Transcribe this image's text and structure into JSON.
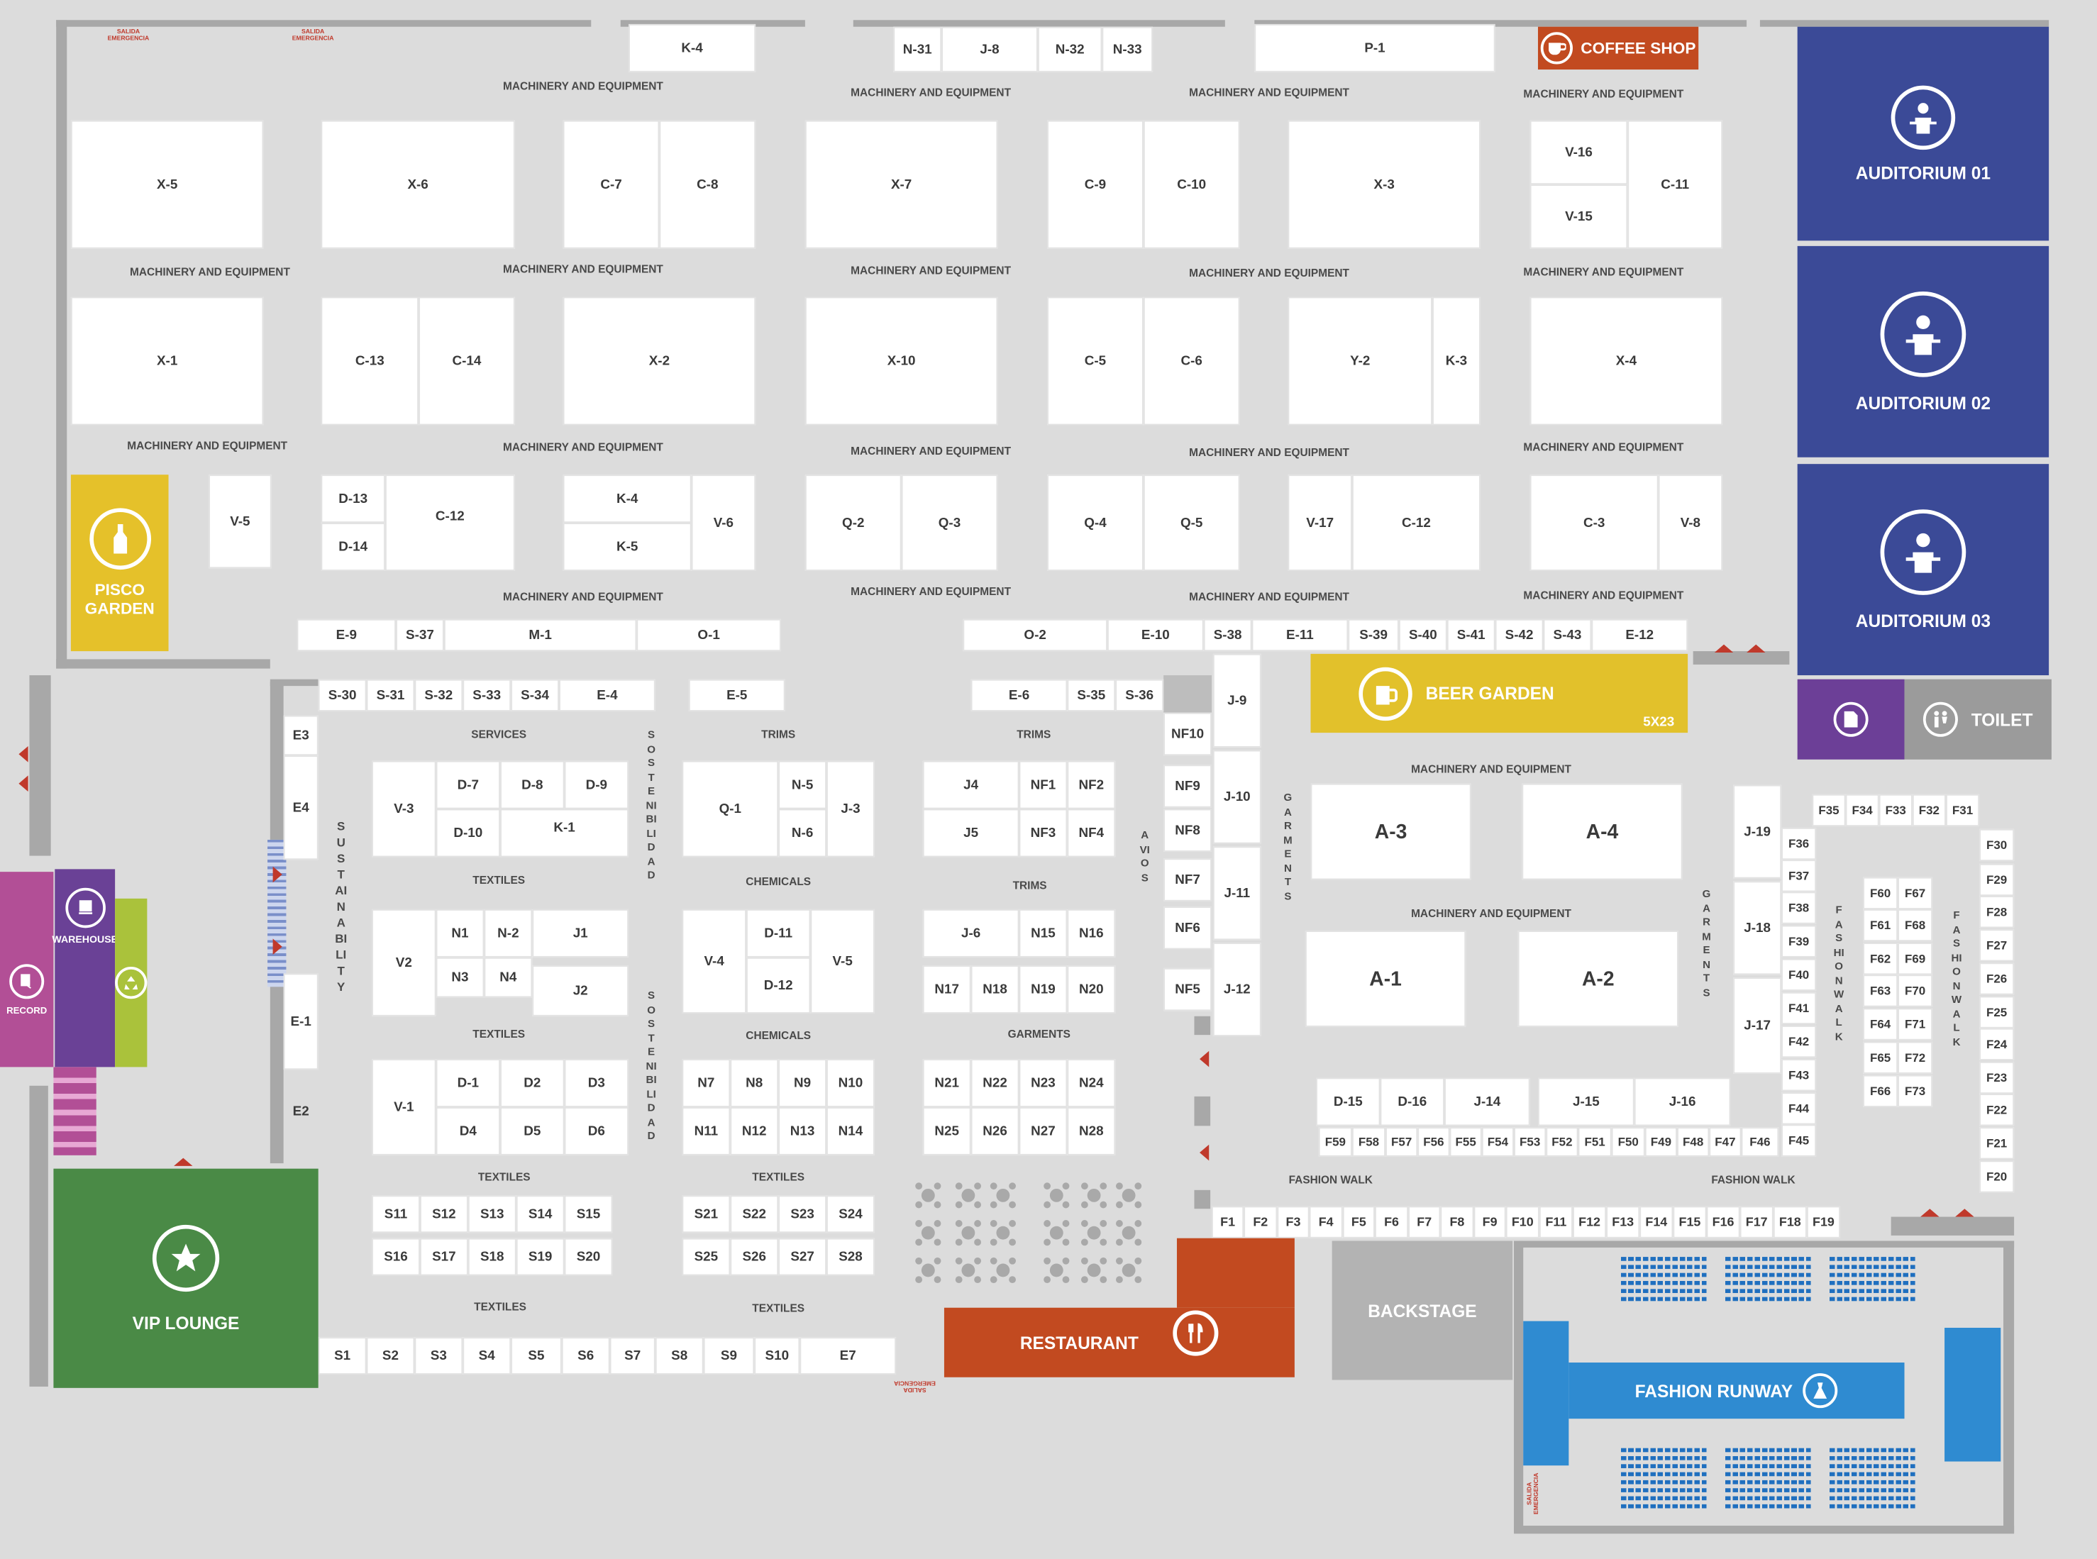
{
  "colors": {
    "auditorium": "#3b4a97",
    "pisco": "#e5c12a",
    "beer": "#e2c12b",
    "coffee": "#c24a20",
    "restaurant": "#c24a20",
    "vip": "#4a8a46",
    "backstage": "#b3b3b3",
    "runway": "#2f8bd1",
    "warehouse": "#6a4196",
    "record": "#b24f96",
    "recycle": "#aac23b",
    "purple_small": "#6c3f97",
    "toilet": "#9b9b9b"
  },
  "labels": {
    "mae": "MACHINERY AND EQUIPMENT",
    "services": "SERVICES",
    "trims": "TRIMS",
    "textiles": "TEXTILES",
    "chemicals": "CHEMICALS",
    "garments": "GARMENTS",
    "fashion_walk": "FASHION WALK",
    "sustainability": "SUSTAINABILITY",
    "sostenibilidad": "SOSTENIBILIDAD",
    "avios": "AVIOS",
    "garments_v": "GARMENTS",
    "fashion_walk_v": "FASHIONWALK",
    "auditorium_01": "AUDITORIUM 01",
    "auditorium_02": "AUDITORIUM 02",
    "auditorium_03": "AUDITORIUM 03",
    "coffee_shop": "COFFEE SHOP",
    "pisco_garden": "PISCO GARDEN",
    "beer_garden": "BEER GARDEN",
    "beer_size": "5X23",
    "toilet": "TOILET",
    "warehouse": "WAREHOUSE",
    "record": "RECORD",
    "vip_lounge": "VIP LOUNGE",
    "restaurant": "RESTAURANT",
    "backstage": "BACKSTAGE",
    "fashion_runway": "FASHION RUNWAY",
    "exit": "SALIDA EMERGENCIA"
  },
  "booths": {
    "K-4top": "K-4",
    "N-31": "N-31",
    "J-8": "J-8",
    "N-32": "N-32",
    "N-33": "N-33",
    "P-1": "P-1",
    "X-5": "X-5",
    "X-6": "X-6",
    "C-7": "C-7",
    "C-8": "C-8",
    "X-7": "X-7",
    "C-9": "C-9",
    "C-10": "C-10",
    "X-3": "X-3",
    "V-16": "V-16",
    "V-15": "V-15",
    "C-11": "C-11",
    "X-1": "X-1",
    "C-13": "C-13",
    "C-14": "C-14",
    "X-2": "X-2",
    "X-10": "X-10",
    "C-5": "C-5",
    "C-6": "C-6",
    "Y-2": "Y-2",
    "K-3": "K-3",
    "X-4": "X-4",
    "V-5": "V-5",
    "D-13": "D-13",
    "D-14": "D-14",
    "C-12a": "C-12",
    "K-4b": "K-4",
    "K-5": "K-5",
    "V-6": "V-6",
    "Q-2": "Q-2",
    "Q-3": "Q-3",
    "Q-4": "Q-4",
    "Q-5": "Q-5",
    "V-17": "V-17",
    "C-12b": "C-12",
    "C-3": "C-3",
    "V-8": "V-8",
    "E-9": "E-9",
    "S-37": "S-37",
    "M-1": "M-1",
    "O-1": "O-1",
    "O-2": "O-2",
    "E-10": "E-10",
    "S-38": "S-38",
    "E-11": "E-11",
    "S-39": "S-39",
    "S-40": "S-40",
    "S-41": "S-41",
    "S-42": "S-42",
    "S-43": "S-43",
    "E-12": "E-12",
    "S-30": "S-30",
    "S-31": "S-31",
    "S-32": "S-32",
    "S-33": "S-33",
    "S-34": "S-34",
    "E-4": "E-4",
    "E-5": "E-5",
    "E-6": "E-6",
    "S-35": "S-35",
    "S-36": "S-36",
    "E3": "E3",
    "E4": "E4",
    "E-1": "E-1",
    "E2": "E2",
    "V-3": "V-3",
    "D-7": "D-7",
    "D-8": "D-8",
    "D-9": "D-9",
    "D-10": "D-10",
    "K-1": "K-1",
    "V2": "V2",
    "N1": "N1",
    "N-2": "N-2",
    "J1": "J1",
    "N3": "N3",
    "N4": "N4",
    "J2": "J2",
    "V-1": "V-1",
    "D-1": "D-1",
    "D2": "D2",
    "D3": "D3",
    "D4": "D4",
    "D5": "D5",
    "D6": "D6",
    "S11": "S11",
    "S12": "S12",
    "S13": "S13",
    "S14": "S14",
    "S15": "S15",
    "S16": "S16",
    "S17": "S17",
    "S18": "S18",
    "S19": "S19",
    "S20": "S20",
    "S1": "S1",
    "S2": "S2",
    "S3": "S3",
    "S4": "S4",
    "S5": "S5",
    "S6": "S6",
    "S7": "S7",
    "S8": "S8",
    "S9": "S9",
    "S10": "S10",
    "E7": "E7",
    "Q-1": "Q-1",
    "N-5": "N-5",
    "N-6": "N-6",
    "J-3": "J-3",
    "V-4": "V-4",
    "D-11": "D-11",
    "D-12": "D-12",
    "V-5b": "V-5",
    "N7": "N7",
    "N8": "N8",
    "N9": "N9",
    "N10": "N10",
    "N11": "N11",
    "N12": "N12",
    "N13": "N13",
    "N14": "N14",
    "S21": "S21",
    "S22": "S22",
    "S23": "S23",
    "S24": "S24",
    "S25": "S25",
    "S26": "S26",
    "S27": "S27",
    "S28": "S28",
    "J4": "J4",
    "NF1": "NF1",
    "NF2": "NF2",
    "J5": "J5",
    "NF3": "NF3",
    "NF4": "NF4",
    "J-6": "J-6",
    "N15": "N15",
    "N16": "N16",
    "N17": "N17",
    "N18": "N18",
    "N19": "N19",
    "N20": "N20",
    "N21": "N21",
    "N22": "N22",
    "N23": "N23",
    "N24": "N24",
    "N25": "N25",
    "N26": "N26",
    "N27": "N27",
    "N28": "N28",
    "NF10": "NF10",
    "NF9": "NF9",
    "NF8": "NF8",
    "NF7": "NF7",
    "NF6": "NF6",
    "NF5": "NF5",
    "J-9": "J-9",
    "J-10": "J-10",
    "J-11": "J-11",
    "J-12": "J-12",
    "A-3": "A-3",
    "A-4": "A-4",
    "A-1": "A-1",
    "A-2": "A-2",
    "D-15": "D-15",
    "D-16": "D-16",
    "J-14": "J-14",
    "J-15": "J-15",
    "J-16": "J-16",
    "J-19": "J-19",
    "J-18": "J-18",
    "J-17": "J-17",
    "F35": "F35",
    "F34": "F34",
    "F33": "F33",
    "F32": "F32",
    "F31": "F31",
    "F36": "F36",
    "F37": "F37",
    "F38": "F38",
    "F39": "F39",
    "F40": "F40",
    "F41": "F41",
    "F42": "F42",
    "F43": "F43",
    "F44": "F44",
    "F45": "F45",
    "F60": "F60",
    "F67": "F67",
    "F61": "F61",
    "F68": "F68",
    "F62": "F62",
    "F69": "F69",
    "F63": "F63",
    "F70": "F70",
    "F64": "F64",
    "F71": "F71",
    "F65": "F65",
    "F72": "F72",
    "F66": "F66",
    "F73": "F73",
    "F30": "F30",
    "F29": "F29",
    "F28": "F28",
    "F27": "F27",
    "F26": "F26",
    "F25": "F25",
    "F24": "F24",
    "F23": "F23",
    "F22": "F22",
    "F21": "F21",
    "F20": "F20",
    "F59": "F59",
    "F58": "F58",
    "F57": "F57",
    "F56": "F56",
    "F55": "F55",
    "F54": "F54",
    "F53": "F53",
    "F52": "F52",
    "F51": "F51",
    "F50": "F50",
    "F49": "F49",
    "F48": "F48",
    "F47": "F47",
    "F46": "F46",
    "F1": "F1",
    "F2": "F2",
    "F3": "F3",
    "F4": "F4",
    "F5": "F5",
    "F6": "F6",
    "F7": "F7",
    "F8": "F8",
    "F9": "F9",
    "F10": "F10",
    "F11": "F11",
    "F12": "F12",
    "F13": "F13",
    "F14": "F14",
    "F15": "F15",
    "F16": "F16",
    "F17": "F17",
    "F18": "F18",
    "F19": "F19"
  },
  "icons": {
    "auditorium": "speaker-podium-icon",
    "coffee": "coffee-cup-icon",
    "pisco": "bottle-icon",
    "beer": "beer-mug-icon",
    "vip": "star-icon",
    "restaurant": "fork-knife-icon",
    "runway": "dress-icon",
    "toilet": "toilet-icon",
    "warehouse": "box-cart-icon",
    "record": "record-hand-icon",
    "recycle": "recycle-icon"
  }
}
